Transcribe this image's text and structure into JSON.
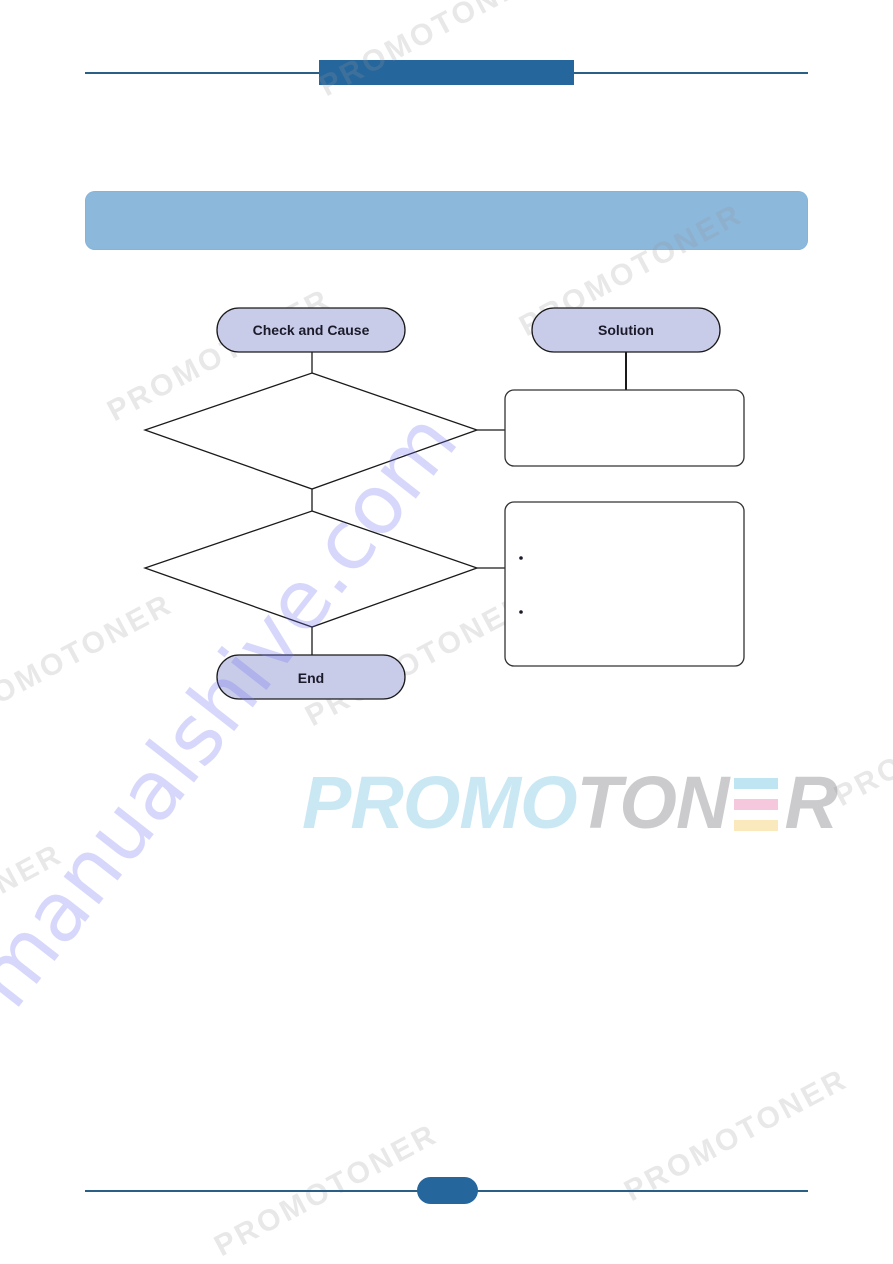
{
  "header": {
    "section_tab_label": "",
    "accent_color": "#25669d"
  },
  "banner": {
    "title": "",
    "color": "#8cb8dc"
  },
  "flowchart": {
    "column_headers": {
      "check_and_cause": "Check and Cause",
      "solution": "Solution"
    },
    "decisions": [
      {
        "text": ""
      },
      {
        "text": ""
      }
    ],
    "solutions": [
      {
        "text": ""
      },
      {
        "text": "",
        "bullets": [
          "",
          ""
        ]
      }
    ],
    "end_label": "End",
    "terminal_fill": "#c9cce9"
  },
  "footer": {
    "page_number": ""
  },
  "watermarks": {
    "promotoner": "PROMOTONER",
    "site": "manualshive.com",
    "logo_left": "PROMO",
    "logo_right_a": "TON",
    "logo_right_b": "R",
    "logo_bar_colors": [
      "#a9dcef",
      "#f3b5d2",
      "#f8e2a6"
    ]
  }
}
